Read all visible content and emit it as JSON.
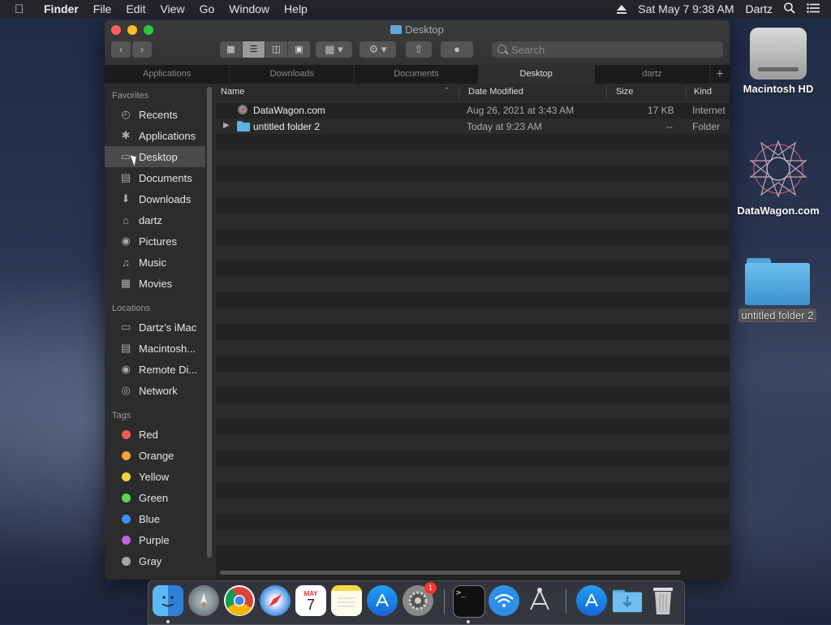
{
  "menubar": {
    "apple": "",
    "items": [
      "Finder",
      "File",
      "Edit",
      "View",
      "Go",
      "Window",
      "Help"
    ],
    "clock": "Sat May 7  9:38 AM",
    "user": "Dartz"
  },
  "window": {
    "title": "Desktop",
    "search_placeholder": "Search"
  },
  "tabs": [
    {
      "label": "Applications",
      "active": false
    },
    {
      "label": "Downloads",
      "active": false
    },
    {
      "label": "Documents",
      "active": false
    },
    {
      "label": "Desktop",
      "active": true
    },
    {
      "label": "dartz",
      "active": false
    }
  ],
  "sidebar": {
    "favorites_label": "Favorites",
    "favorites": [
      {
        "label": "Recents",
        "icon": "clock-icon"
      },
      {
        "label": "Applications",
        "icon": "applications-icon"
      },
      {
        "label": "Desktop",
        "icon": "desktop-icon"
      },
      {
        "label": "Documents",
        "icon": "document-icon"
      },
      {
        "label": "Downloads",
        "icon": "download-icon"
      },
      {
        "label": "dartz",
        "icon": "home-icon"
      },
      {
        "label": "Pictures",
        "icon": "camera-icon"
      },
      {
        "label": "Music",
        "icon": "music-icon"
      },
      {
        "label": "Movies",
        "icon": "film-icon"
      }
    ],
    "locations_label": "Locations",
    "locations": [
      {
        "label": "Dartz’s iMac",
        "icon": "monitor-icon"
      },
      {
        "label": "Macintosh...",
        "icon": "disk-icon"
      },
      {
        "label": "Remote Di...",
        "icon": "disc-icon"
      },
      {
        "label": "Network",
        "icon": "globe-icon"
      }
    ],
    "tags_label": "Tags",
    "tags": [
      {
        "label": "Red",
        "color": "#f25a5a"
      },
      {
        "label": "Orange",
        "color": "#f7a23b"
      },
      {
        "label": "Yellow",
        "color": "#f5d43a"
      },
      {
        "label": "Green",
        "color": "#5ad45a"
      },
      {
        "label": "Blue",
        "color": "#3f8ef5"
      },
      {
        "label": "Purple",
        "color": "#c163e0"
      },
      {
        "label": "Gray",
        "color": "#a5a5a5"
      }
    ]
  },
  "columns": {
    "name": "Name",
    "date": "Date Modified",
    "size": "Size",
    "kind": "Kind"
  },
  "files": [
    {
      "name": "DataWagon.com",
      "date": "Aug 26, 2021 at 3:43 AM",
      "size": "17 KB",
      "kind": "Internet"
    },
    {
      "name": "untitled folder 2",
      "date": "Today at 9:23 AM",
      "size": "--",
      "kind": "Folder"
    }
  ],
  "desktop": {
    "hd_label": "Macintosh HD",
    "site_label": "DataWagon.com",
    "folder_label": "untitled folder 2"
  },
  "dock": {
    "calendar_month": "MAY",
    "calendar_day": "7",
    "prefs_badge": "1",
    "terminal_prompt": ">_"
  }
}
